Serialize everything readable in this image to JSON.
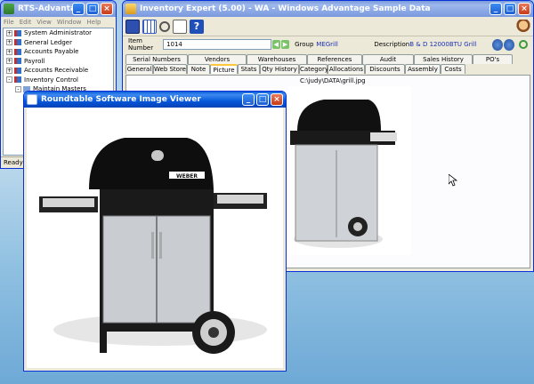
{
  "rts_window": {
    "title": "RTS-Advantage Ac...",
    "menu": [
      "File",
      "Edit",
      "View",
      "Window",
      "Help"
    ],
    "tree": [
      {
        "label": "System Administrator",
        "indent": 0,
        "toggle": "+"
      },
      {
        "label": "General Ledger",
        "indent": 0,
        "toggle": "+"
      },
      {
        "label": "Accounts Payable",
        "indent": 0,
        "toggle": "+"
      },
      {
        "label": "Payroll",
        "indent": 0,
        "toggle": "+"
      },
      {
        "label": "Accounts Receivable",
        "indent": 0,
        "toggle": "+"
      },
      {
        "label": "Inventory Control",
        "indent": 0,
        "toggle": "-"
      },
      {
        "label": "Maintain Masters",
        "indent": 1,
        "toggle": "-"
      }
    ],
    "status": "Ready"
  },
  "inventory_window": {
    "title": "Inventory Expert (5.00) - WA - Windows Advantage Sample Data",
    "item_number_label": "Item Number",
    "item_number_value": "1014",
    "group_label": "Group",
    "group_value": "MEGrill",
    "description_label": "Description",
    "description_value": "B & D 12000BTU Grill",
    "tabs_row1": [
      "Serial Numbers",
      "Vendors",
      "Warehouses",
      "References",
      "Audit",
      "Sales History",
      "PO's"
    ],
    "tabs_row2": [
      "General",
      "Web Store",
      "Note",
      "Picture",
      "Stats",
      "Qty History",
      "Category",
      "Allocations",
      "Discounts",
      "Assembly",
      "Costs"
    ],
    "active_tab": "Picture",
    "picture_path": "C:\\judy\\DATA\\grill.jpg"
  },
  "viewer_window": {
    "title": "Roundtable Software Image Viewer"
  },
  "brand_text": "WEBER",
  "colors": {
    "titlebar_active": "#0557d9",
    "window_bg": "#ece9d8",
    "desktop": "#a7cde8"
  }
}
